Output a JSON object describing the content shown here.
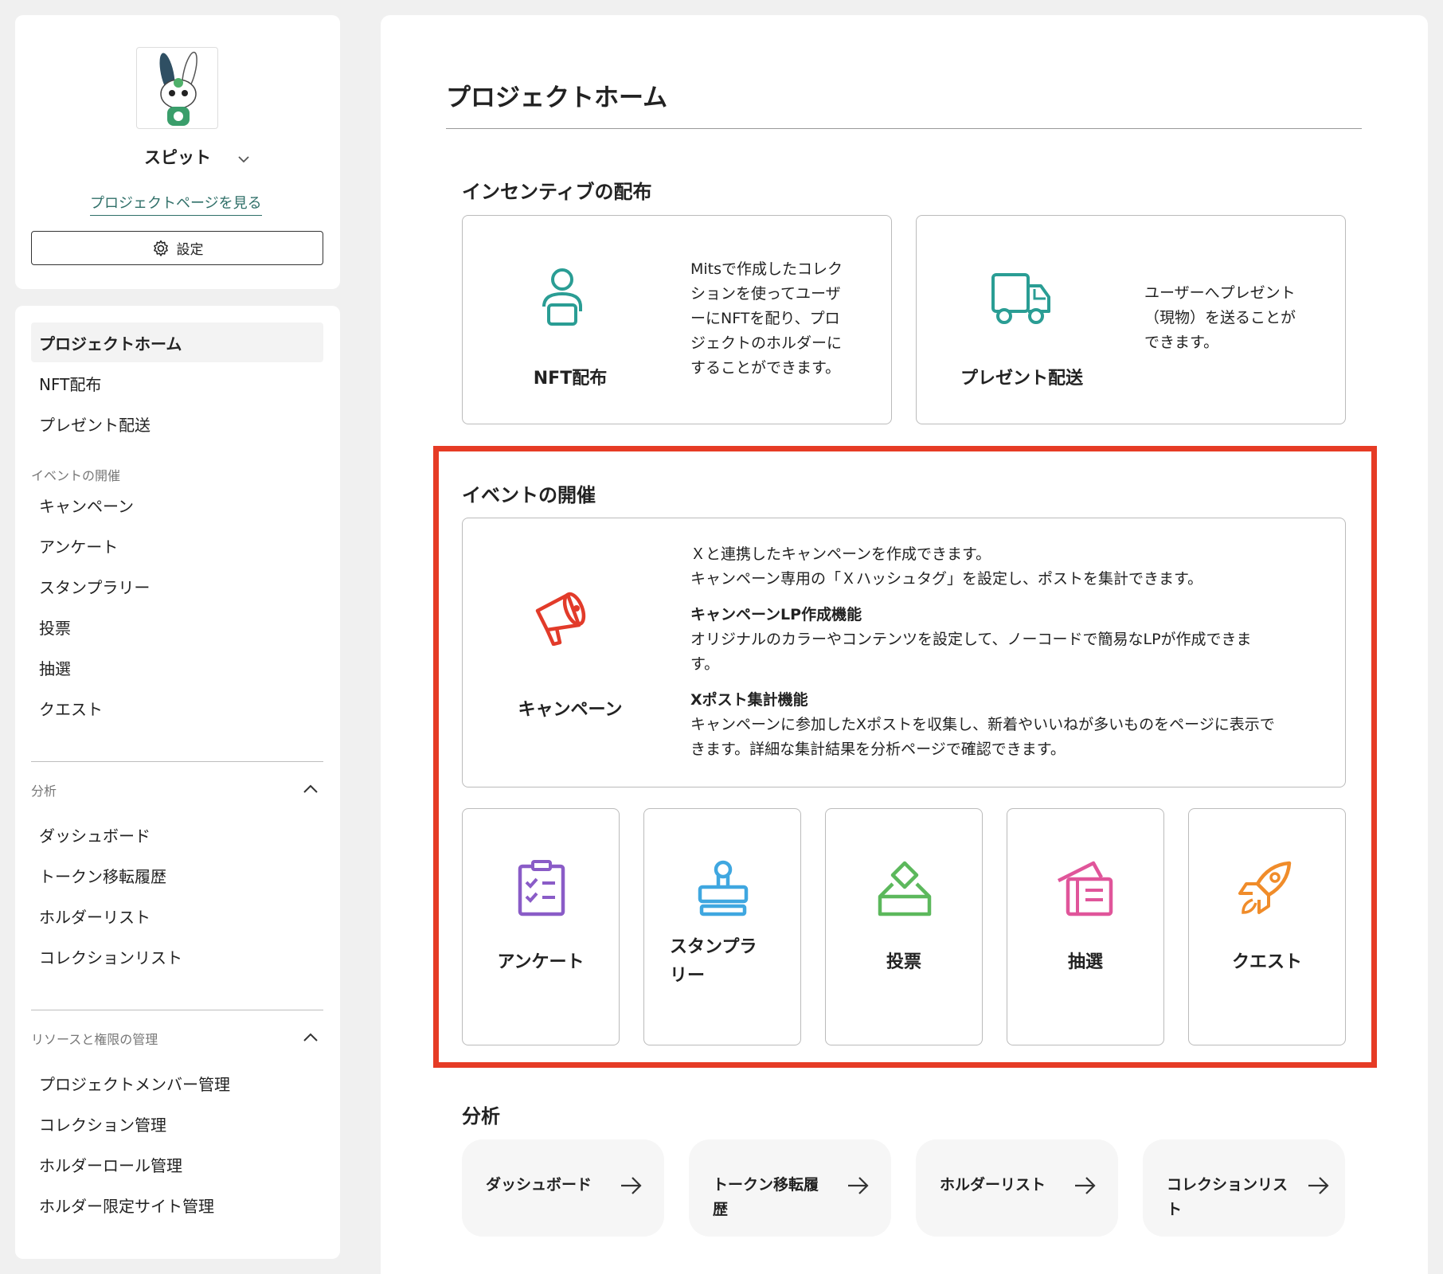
{
  "project": {
    "name": "スピット",
    "view_page_link": "プロジェクトページを見る",
    "settings_label": "設定"
  },
  "sidebar": {
    "home": "プロジェクトホーム",
    "nft": "NFT配布",
    "present": "プレゼント配送",
    "events_label": "イベントの開催",
    "events": [
      "キャンペーン",
      "アンケート",
      "スタンプラリー",
      "投票",
      "抽選",
      "クエスト"
    ],
    "analysis_label": "分析",
    "analysis": [
      "ダッシュボード",
      "トークン移転履歴",
      "ホルダーリスト",
      "コレクションリスト"
    ],
    "resources_label": "リソースと権限の管理",
    "resources": [
      "プロジェクトメンバー管理",
      "コレクション管理",
      "ホルダーロール管理",
      "ホルダー限定サイト管理"
    ]
  },
  "main": {
    "title": "プロジェクトホーム",
    "incentive": {
      "heading": "インセンティブの配布",
      "nft_title": "NFT配布",
      "nft_desc": [
        "Mitsで作成したコレク",
        "ションを使ってユーザ",
        "ーにNFTを配り、プロ",
        "ジェクトのホルダーに",
        "することができます。"
      ],
      "present_title": "プレゼント配送",
      "present_desc": [
        "ユーザーへプレゼント",
        "（現物）を送ることが",
        "できます。"
      ]
    },
    "events": {
      "heading": "イベントの開催",
      "campaign_title": "キャンペーン",
      "campaign_desc_1": "Ｘと連携したキャンペーンを作成できます。",
      "campaign_desc_2": "キャンペーン専用の「Ｘハッシュタグ」を設定し、ポストを集計できます。",
      "lp_title": "キャンペーンLP作成機能",
      "lp_desc_1": "オリジナルのカラーやコンテンツを設定して、ノーコードで簡易なLPが作成できま",
      "lp_desc_2": "す。",
      "xpost_title": "Xポスト集計機能",
      "xpost_desc_1": "キャンペーンに参加したXポストを収集し、新着やいいねが多いものをページに表示で",
      "xpost_desc_2": "きます。詳細な集計結果を分析ページで確認できます。",
      "survey": "アンケート",
      "stamp_1": "スタンプラ",
      "stamp_2": "リー",
      "vote": "投票",
      "lottery": "抽選",
      "quest": "クエスト"
    },
    "analysis": {
      "heading": "分析",
      "dashboard": "ダッシュボード",
      "token_1": "トークン移転履",
      "token_2": "歴",
      "holder": "ホルダーリスト",
      "coll_1": "コレクションリス",
      "coll_2": "ト"
    }
  },
  "colors": {
    "nft_icon": "#2a9d94",
    "campaign_icon": "#e23b2a",
    "survey_icon": "#8a5cc7",
    "stamp_icon": "#3fa7e0",
    "vote_icon": "#5cb85c",
    "lottery_icon": "#e0559a",
    "quest_icon": "#f08c2a",
    "highlight": "#e63b25"
  }
}
